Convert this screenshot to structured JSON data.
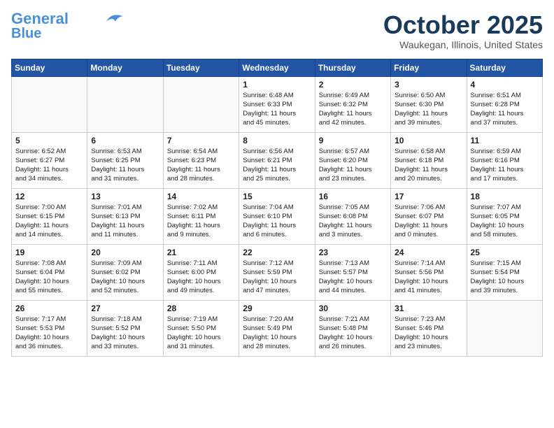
{
  "header": {
    "logo_line1": "General",
    "logo_line2": "Blue",
    "month": "October 2025",
    "location": "Waukegan, Illinois, United States"
  },
  "days_of_week": [
    "Sunday",
    "Monday",
    "Tuesday",
    "Wednesday",
    "Thursday",
    "Friday",
    "Saturday"
  ],
  "weeks": [
    [
      {
        "day": "",
        "info": ""
      },
      {
        "day": "",
        "info": ""
      },
      {
        "day": "",
        "info": ""
      },
      {
        "day": "1",
        "info": "Sunrise: 6:48 AM\nSunset: 6:33 PM\nDaylight: 11 hours\nand 45 minutes."
      },
      {
        "day": "2",
        "info": "Sunrise: 6:49 AM\nSunset: 6:32 PM\nDaylight: 11 hours\nand 42 minutes."
      },
      {
        "day": "3",
        "info": "Sunrise: 6:50 AM\nSunset: 6:30 PM\nDaylight: 11 hours\nand 39 minutes."
      },
      {
        "day": "4",
        "info": "Sunrise: 6:51 AM\nSunset: 6:28 PM\nDaylight: 11 hours\nand 37 minutes."
      }
    ],
    [
      {
        "day": "5",
        "info": "Sunrise: 6:52 AM\nSunset: 6:27 PM\nDaylight: 11 hours\nand 34 minutes."
      },
      {
        "day": "6",
        "info": "Sunrise: 6:53 AM\nSunset: 6:25 PM\nDaylight: 11 hours\nand 31 minutes."
      },
      {
        "day": "7",
        "info": "Sunrise: 6:54 AM\nSunset: 6:23 PM\nDaylight: 11 hours\nand 28 minutes."
      },
      {
        "day": "8",
        "info": "Sunrise: 6:56 AM\nSunset: 6:21 PM\nDaylight: 11 hours\nand 25 minutes."
      },
      {
        "day": "9",
        "info": "Sunrise: 6:57 AM\nSunset: 6:20 PM\nDaylight: 11 hours\nand 23 minutes."
      },
      {
        "day": "10",
        "info": "Sunrise: 6:58 AM\nSunset: 6:18 PM\nDaylight: 11 hours\nand 20 minutes."
      },
      {
        "day": "11",
        "info": "Sunrise: 6:59 AM\nSunset: 6:16 PM\nDaylight: 11 hours\nand 17 minutes."
      }
    ],
    [
      {
        "day": "12",
        "info": "Sunrise: 7:00 AM\nSunset: 6:15 PM\nDaylight: 11 hours\nand 14 minutes."
      },
      {
        "day": "13",
        "info": "Sunrise: 7:01 AM\nSunset: 6:13 PM\nDaylight: 11 hours\nand 11 minutes."
      },
      {
        "day": "14",
        "info": "Sunrise: 7:02 AM\nSunset: 6:11 PM\nDaylight: 11 hours\nand 9 minutes."
      },
      {
        "day": "15",
        "info": "Sunrise: 7:04 AM\nSunset: 6:10 PM\nDaylight: 11 hours\nand 6 minutes."
      },
      {
        "day": "16",
        "info": "Sunrise: 7:05 AM\nSunset: 6:08 PM\nDaylight: 11 hours\nand 3 minutes."
      },
      {
        "day": "17",
        "info": "Sunrise: 7:06 AM\nSunset: 6:07 PM\nDaylight: 11 hours\nand 0 minutes."
      },
      {
        "day": "18",
        "info": "Sunrise: 7:07 AM\nSunset: 6:05 PM\nDaylight: 10 hours\nand 58 minutes."
      }
    ],
    [
      {
        "day": "19",
        "info": "Sunrise: 7:08 AM\nSunset: 6:04 PM\nDaylight: 10 hours\nand 55 minutes."
      },
      {
        "day": "20",
        "info": "Sunrise: 7:09 AM\nSunset: 6:02 PM\nDaylight: 10 hours\nand 52 minutes."
      },
      {
        "day": "21",
        "info": "Sunrise: 7:11 AM\nSunset: 6:00 PM\nDaylight: 10 hours\nand 49 minutes."
      },
      {
        "day": "22",
        "info": "Sunrise: 7:12 AM\nSunset: 5:59 PM\nDaylight: 10 hours\nand 47 minutes."
      },
      {
        "day": "23",
        "info": "Sunrise: 7:13 AM\nSunset: 5:57 PM\nDaylight: 10 hours\nand 44 minutes."
      },
      {
        "day": "24",
        "info": "Sunrise: 7:14 AM\nSunset: 5:56 PM\nDaylight: 10 hours\nand 41 minutes."
      },
      {
        "day": "25",
        "info": "Sunrise: 7:15 AM\nSunset: 5:54 PM\nDaylight: 10 hours\nand 39 minutes."
      }
    ],
    [
      {
        "day": "26",
        "info": "Sunrise: 7:17 AM\nSunset: 5:53 PM\nDaylight: 10 hours\nand 36 minutes."
      },
      {
        "day": "27",
        "info": "Sunrise: 7:18 AM\nSunset: 5:52 PM\nDaylight: 10 hours\nand 33 minutes."
      },
      {
        "day": "28",
        "info": "Sunrise: 7:19 AM\nSunset: 5:50 PM\nDaylight: 10 hours\nand 31 minutes."
      },
      {
        "day": "29",
        "info": "Sunrise: 7:20 AM\nSunset: 5:49 PM\nDaylight: 10 hours\nand 28 minutes."
      },
      {
        "day": "30",
        "info": "Sunrise: 7:21 AM\nSunset: 5:48 PM\nDaylight: 10 hours\nand 26 minutes."
      },
      {
        "day": "31",
        "info": "Sunrise: 7:23 AM\nSunset: 5:46 PM\nDaylight: 10 hours\nand 23 minutes."
      },
      {
        "day": "",
        "info": ""
      }
    ]
  ]
}
